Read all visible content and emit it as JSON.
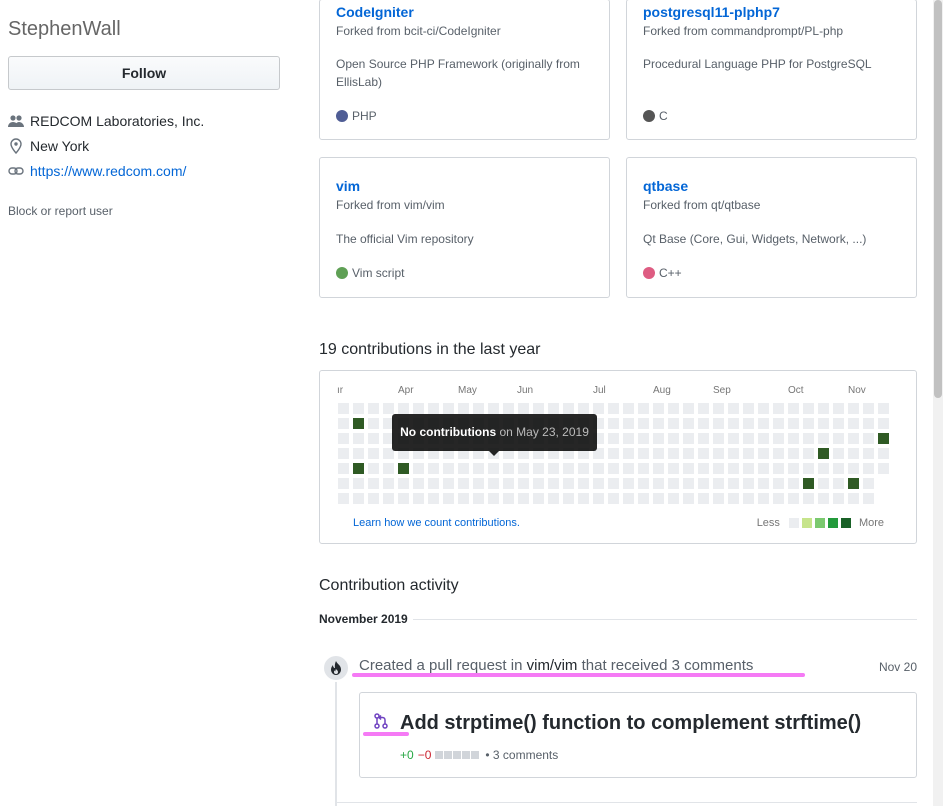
{
  "profile": {
    "username": "StephenWall",
    "follow_label": "Follow",
    "company": "REDCOM Laboratories, Inc.",
    "location": "New York",
    "website": "https://www.redcom.com/",
    "block_label": "Block or report user"
  },
  "repos": [
    {
      "name": "CodeIgniter",
      "fork": "Forked from bcit-ci/CodeIgniter",
      "desc": "Open Source PHP Framework (originally from EllisLab)",
      "lang": "PHP",
      "lang_color": "#4F5D95"
    },
    {
      "name": "postgresql11-plphp7",
      "fork": "Forked from commandprompt/PL-php",
      "desc": "Procedural Language PHP for PostgreSQL",
      "lang": "C",
      "lang_color": "#555555"
    },
    {
      "name": "vim",
      "fork": "Forked from vim/vim",
      "desc": "The official Vim repository",
      "lang": "Vim script",
      "lang_color": "#5fa055"
    },
    {
      "name": "qtbase",
      "fork": "Forked from qt/qtbase",
      "desc": "Qt Base (Core, Gui, Widgets, Network, ...)",
      "lang": "C++",
      "lang_color": "#de5c82"
    }
  ],
  "contributions": {
    "title": "19 contributions in the last year",
    "months": [
      "ır",
      "Apr",
      "May",
      "Jun",
      "Jul",
      "Aug",
      "Sep",
      "Oct",
      "Nov"
    ],
    "learn_label": "Learn how we count contributions.",
    "legend_less": "Less",
    "legend_more": "More",
    "legend_colors": [
      "#ebedf0",
      "#c6e48b",
      "#7bc96f",
      "#239a3b",
      "#196127"
    ],
    "tooltip_bold": "No contributions",
    "tooltip_rest": "on May 23, 2019",
    "empty_color": "#ebedf0",
    "active_color": "#2f5a24",
    "active_cells": [
      [
        1,
        1
      ],
      [
        1,
        4
      ],
      [
        4,
        4
      ],
      [
        36,
        2
      ],
      [
        32,
        3
      ],
      [
        31,
        5
      ],
      [
        34,
        5
      ]
    ]
  },
  "activity": {
    "title": "Contribution activity",
    "month": "November 2019",
    "event_prefix": "Created a pull request in",
    "event_repo": "vim/vim",
    "event_suffix": "that received 3 comments",
    "event_date": "Nov 20",
    "pr_title": "Add strptime() function to complement strftime()",
    "pr_add": "+0",
    "pr_del": "−0",
    "pr_comments": "• 3 comments"
  }
}
